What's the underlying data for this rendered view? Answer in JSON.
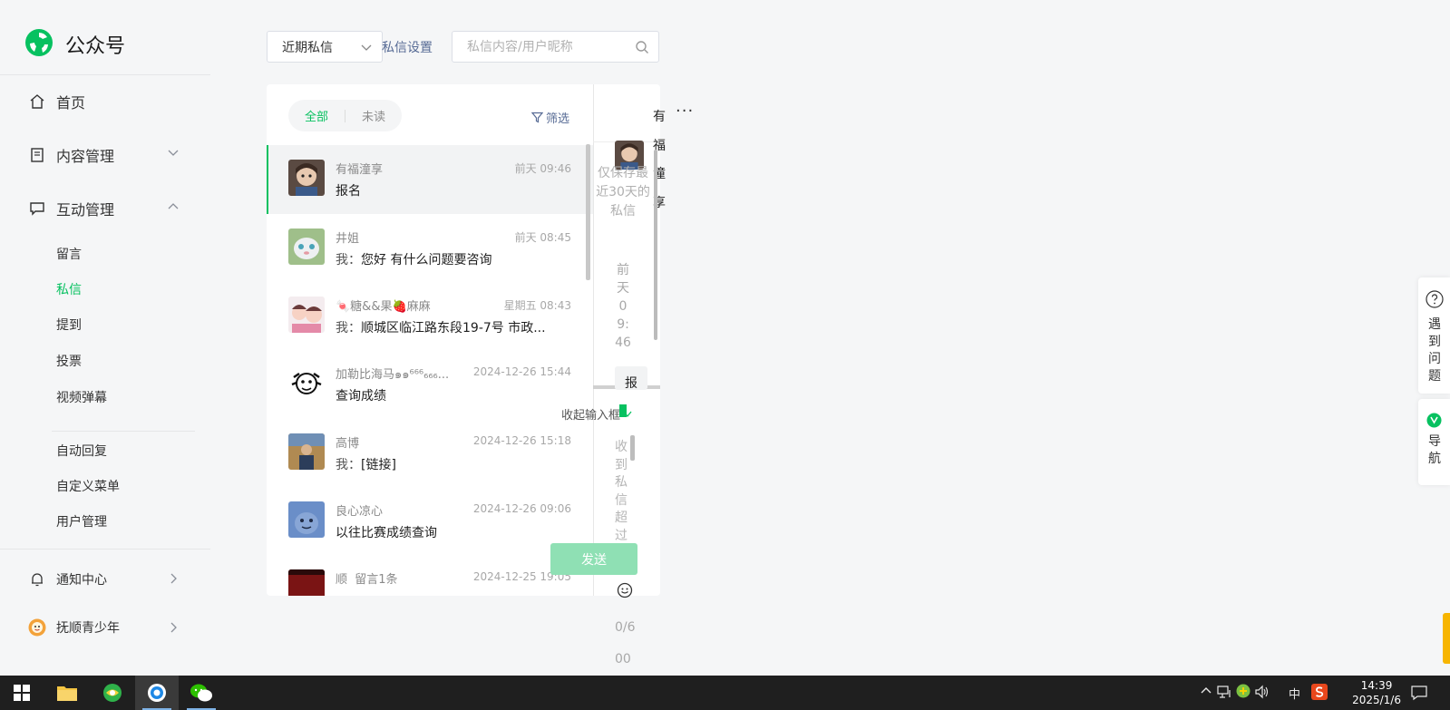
{
  "app": {
    "title": "公众号"
  },
  "sidebar": {
    "home": "首页",
    "content_mgmt": "内容管理",
    "interaction_mgmt": "互动管理",
    "sub_items": [
      "留言",
      "私信",
      "提到",
      "投票",
      "视频弹幕"
    ],
    "sub_items2": [
      "自动回复",
      "自定义菜单",
      "用户管理"
    ],
    "notification": "通知中心",
    "account": "抚顺青少年"
  },
  "toolbar": {
    "filter_select": "近期私信",
    "settings_link": "私信设置",
    "search_placeholder": "私信内容/用户昵称"
  },
  "list": {
    "tabs": [
      "全部",
      "未读"
    ],
    "filter": "筛选",
    "messages": [
      {
        "name": "有福潼享",
        "time": "前天 09:46",
        "me": "",
        "text": "报名"
      },
      {
        "name": "井姐",
        "time": "前天 08:45",
        "me": "我：",
        "text": "您好  有什么问题要咨询"
      },
      {
        "name": "🍬糖&&果🍓麻麻",
        "time": "星期五 08:43",
        "me": "我：",
        "text": "顺城区临江路东段19-7号    市政..."
      },
      {
        "name": "加勒比海马๑๑⁶⁶⁶₆₆₆...",
        "time": "2024-12-26 15:44",
        "me": "",
        "text": "查询成绩"
      },
      {
        "name": "高博",
        "time": "2024-12-26 15:18",
        "me": "我：",
        "text": "[链接]"
      },
      {
        "name": "良心凉心",
        "time": "2024-12-26 09:06",
        "me": "",
        "text": "以往比赛成绩查询"
      },
      {
        "name": "顺",
        "time": "2024-12-25 19:05",
        "me": "",
        "text": ""
      }
    ],
    "partial_row_tag": "留言1条"
  },
  "chat": {
    "contact_name_chars": [
      "有",
      "福",
      "潼",
      "享"
    ],
    "notice_lines": [
      "仅保存最",
      "近30天的",
      "私信"
    ],
    "time_chars": [
      "前",
      "天",
      "0",
      "9:",
      "46"
    ],
    "collapse_input": "收起输入框",
    "input_placeholder_chars": [
      "收",
      "到",
      "私",
      "信",
      "超",
      "过"
    ],
    "send_button": "发送",
    "counter_lines": [
      "0/6",
      "00"
    ],
    "bubble_char": "报"
  },
  "floating": {
    "help": [
      "遇",
      "到",
      "问",
      "题"
    ],
    "nav": [
      "导",
      "航"
    ]
  },
  "taskbar": {
    "ime": "中",
    "time": "14:39",
    "date": "2025/1/6"
  },
  "colors": {
    "accent": "#07c160",
    "link": "#576b95",
    "send_disabled": "#8fe0b4"
  }
}
